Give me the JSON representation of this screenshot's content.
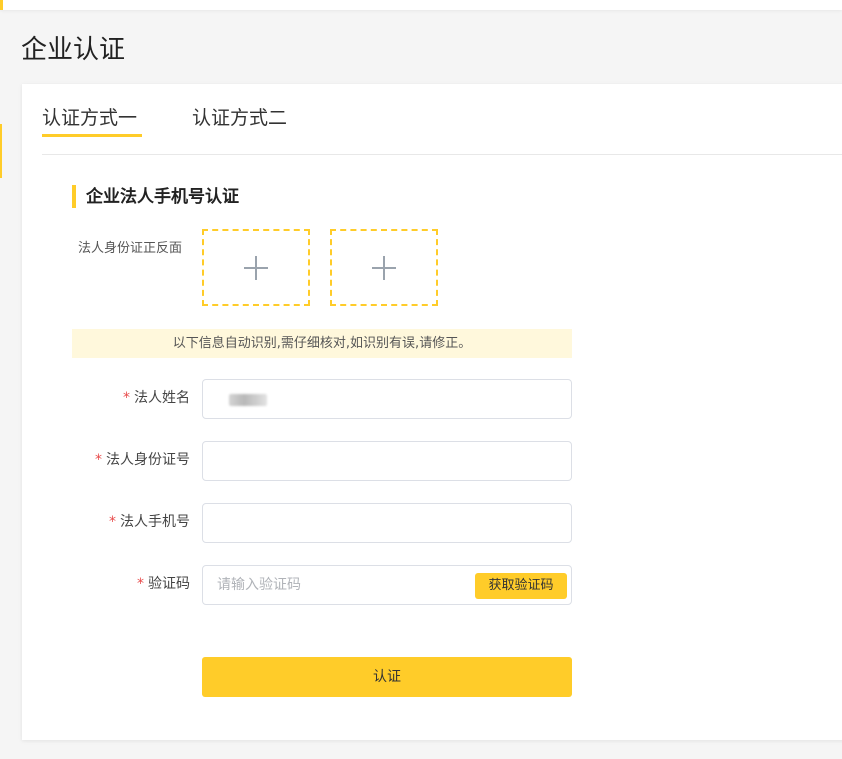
{
  "page": {
    "title": "企业认证"
  },
  "tabs": [
    {
      "label": "认证方式一",
      "active": true
    },
    {
      "label": "认证方式二",
      "active": false
    }
  ],
  "section": {
    "title": "企业法人手机号认证"
  },
  "upload": {
    "label": "法人身份证正反面",
    "icon": "plus-icon"
  },
  "notice": "以下信息自动识别,需仔细核对,如识别有误,请修正。",
  "form": {
    "required_mark": "*",
    "name_label": "法人姓名",
    "id_label": "法人身份证号",
    "phone_label": "法人手机号",
    "code_label": "验证码",
    "code_placeholder": "请输入验证码",
    "code_button": "获取验证码"
  },
  "submit_label": "认证",
  "colors": {
    "accent": "#ffcc29",
    "notice_bg": "#fff8dc",
    "required": "#e84a4a"
  }
}
